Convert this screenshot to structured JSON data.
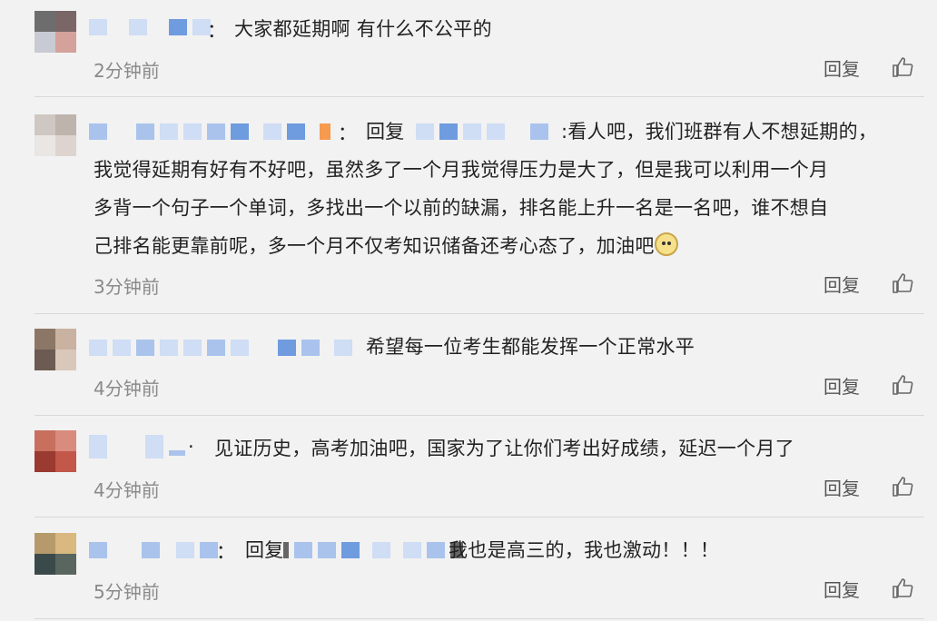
{
  "comments": [
    {
      "text": "大家都延期啊 有什么不公平的",
      "time": "2分钟前",
      "reply_label": "回复"
    },
    {
      "reply_prefix": "回复",
      "line1": ":看人吧，我们班群有人不想延期的，",
      "line2": "我觉得延期有好有不好吧，虽然多了一个月我觉得压力是大了，但是我可以利用一个月",
      "line3": "多背一个句子一个单词，多找出一个以前的缺漏，排名能上升一名是一名吧，谁不想自",
      "line4": "己排名能更靠前呢，多一个月不仅考知识储备还考心态了，加油吧",
      "emoji": "doge-emoji",
      "time": "3分钟前",
      "reply_label": "回复"
    },
    {
      "text": "希望每一位考生都能发挥一个正常水平",
      "time": "4分钟前",
      "reply_label": "回复"
    },
    {
      "text": "见证历史，高考加油吧，国家为了让你们考出好成绩，延迟一个月了",
      "time": "4分钟前",
      "reply_label": "回复"
    },
    {
      "reply_prefix": "回复",
      "text": "我也是高三的，我也激动！！！",
      "time": "5分钟前",
      "reply_label": "回复"
    }
  ],
  "colon": "：",
  "dot": "·",
  "like_icon": "thumbs-up-icon"
}
